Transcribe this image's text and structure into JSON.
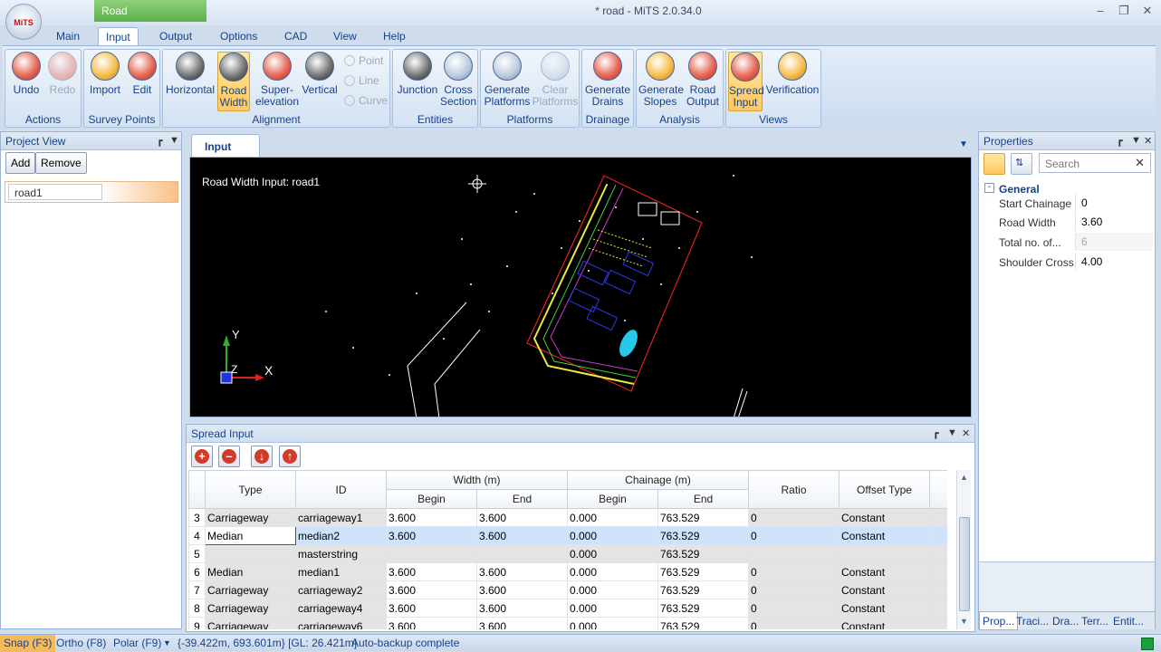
{
  "app": {
    "title": "* road - MiTS 2.0.34.0",
    "context_tab": "Road",
    "logo": "MiTS"
  },
  "menu_tabs": [
    "Main",
    "Input",
    "Output",
    "Options",
    "CAD",
    "View",
    "Help"
  ],
  "ribbon": {
    "groups": {
      "actions": "Actions",
      "survey_points": "Survey Points",
      "alignment": "Alignment",
      "entities": "Entities",
      "platforms": "Platforms",
      "drainage": "Drainage",
      "analysis": "Analysis",
      "views": "Views"
    },
    "buttons": {
      "undo": "Undo",
      "redo": "Redo",
      "import": "Import",
      "edit": "Edit",
      "horizontal": "Horizontal",
      "road_width": "Road Width",
      "superelevation": "Super-elevation",
      "vertical": "Vertical",
      "point": "Point",
      "line": "Line",
      "curve": "Curve",
      "junction": "Junction",
      "cross_section": "Cross Section",
      "generate_platforms": "Generate Platforms",
      "clear_platforms": "Clear Platforms",
      "generate_drains": "Generate Drains",
      "generate_slopes": "Generate Slopes",
      "road_output": "Road Output",
      "spread_input": "Spread Input",
      "verification": "Verification"
    }
  },
  "project_view": {
    "title": "Project View",
    "add": "Add",
    "remove": "Remove",
    "item": "road1"
  },
  "document": {
    "tab": "Input",
    "viewport_label": "Road Width Input: road1",
    "axis_y": "Y",
    "axis_z": "Z",
    "axis_x": "X"
  },
  "spread_input": {
    "title": "Spread Input",
    "headers": {
      "type": "Type",
      "id": "ID",
      "width": "Width (m)",
      "chainage": "Chainage (m)",
      "begin": "Begin",
      "end": "End",
      "ratio": "Ratio",
      "offset_type": "Offset Type"
    },
    "rows": [
      {
        "n": "3",
        "type": "Carriageway",
        "id": "carriageway1",
        "wb": "3.600",
        "we": "3.600",
        "cb": "0.000",
        "ce": "763.529",
        "ratio": "0",
        "offset": "Constant"
      },
      {
        "n": "4",
        "type": "Median",
        "id": "median2",
        "wb": "3.600",
        "we": "3.600",
        "cb": "0.000",
        "ce": "763.529",
        "ratio": "0",
        "offset": "Constant"
      },
      {
        "n": "5",
        "type": "",
        "id": "masterstring",
        "wb": "",
        "we": "",
        "cb": "0.000",
        "ce": "763.529",
        "ratio": "",
        "offset": ""
      },
      {
        "n": "6",
        "type": "Median",
        "id": "median1",
        "wb": "3.600",
        "we": "3.600",
        "cb": "0.000",
        "ce": "763.529",
        "ratio": "0",
        "offset": "Constant"
      },
      {
        "n": "7",
        "type": "Carriageway",
        "id": "carriageway2",
        "wb": "3.600",
        "we": "3.600",
        "cb": "0.000",
        "ce": "763.529",
        "ratio": "0",
        "offset": "Constant"
      },
      {
        "n": "8",
        "type": "Carriageway",
        "id": "carriageway4",
        "wb": "3.600",
        "we": "3.600",
        "cb": "0.000",
        "ce": "763.529",
        "ratio": "0",
        "offset": "Constant"
      },
      {
        "n": "9",
        "type": "Carriageway",
        "id": "carriageway6",
        "wb": "3.600",
        "we": "3.600",
        "cb": "0.000",
        "ce": "763.529",
        "ratio": "0",
        "offset": "Constant"
      }
    ]
  },
  "properties": {
    "title": "Properties",
    "search_placeholder": "Search",
    "category": "General",
    "items": [
      {
        "key": "Start Chainage",
        "value": "0"
      },
      {
        "key": "Road Width",
        "value": "3.60"
      },
      {
        "key": "Total no. of...",
        "value": "6"
      },
      {
        "key": "Shoulder Cross...",
        "value": "4.00"
      }
    ],
    "tabs": [
      "Prop...",
      "Traci...",
      "Dra...",
      "Terr...",
      "Entit..."
    ]
  },
  "statusbar": {
    "snap": "Snap (F3)",
    "ortho": "Ortho (F8)",
    "polar": "Polar (F9)",
    "coords": "{-39.422m, 693.601m} [GL: 26.421m]",
    "message": "Auto-backup complete"
  }
}
